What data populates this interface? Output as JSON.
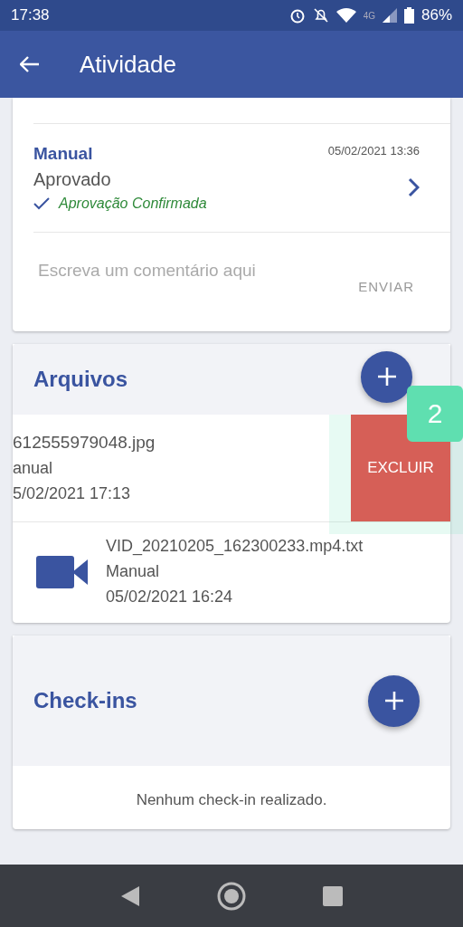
{
  "status_bar": {
    "time": "17:38",
    "battery": "86%",
    "network": "4G"
  },
  "app_bar": {
    "title": "Atividade"
  },
  "activity": {
    "source": "Manual",
    "date": "05/02/2021 13:36",
    "status": "Aprovado",
    "confirmation": "Aprovação Confirmada",
    "comment": {
      "placeholder": "Escreva um comentário aqui",
      "send": "ENVIAR"
    }
  },
  "files": {
    "title": "Arquivos",
    "items": [
      {
        "kind": "swiped",
        "name": "612555979048.jpg",
        "source": "anual",
        "date": "5/02/2021 17:13",
        "action": "EXCLUIR",
        "tip_badge": "2"
      },
      {
        "kind": "video",
        "name": "VID_20210205_162300233.mp4.txt",
        "source": "Manual",
        "date": "05/02/2021 16:24"
      }
    ]
  },
  "checkins": {
    "title": "Check-ins",
    "empty": "Nenhum check-in realizado."
  }
}
